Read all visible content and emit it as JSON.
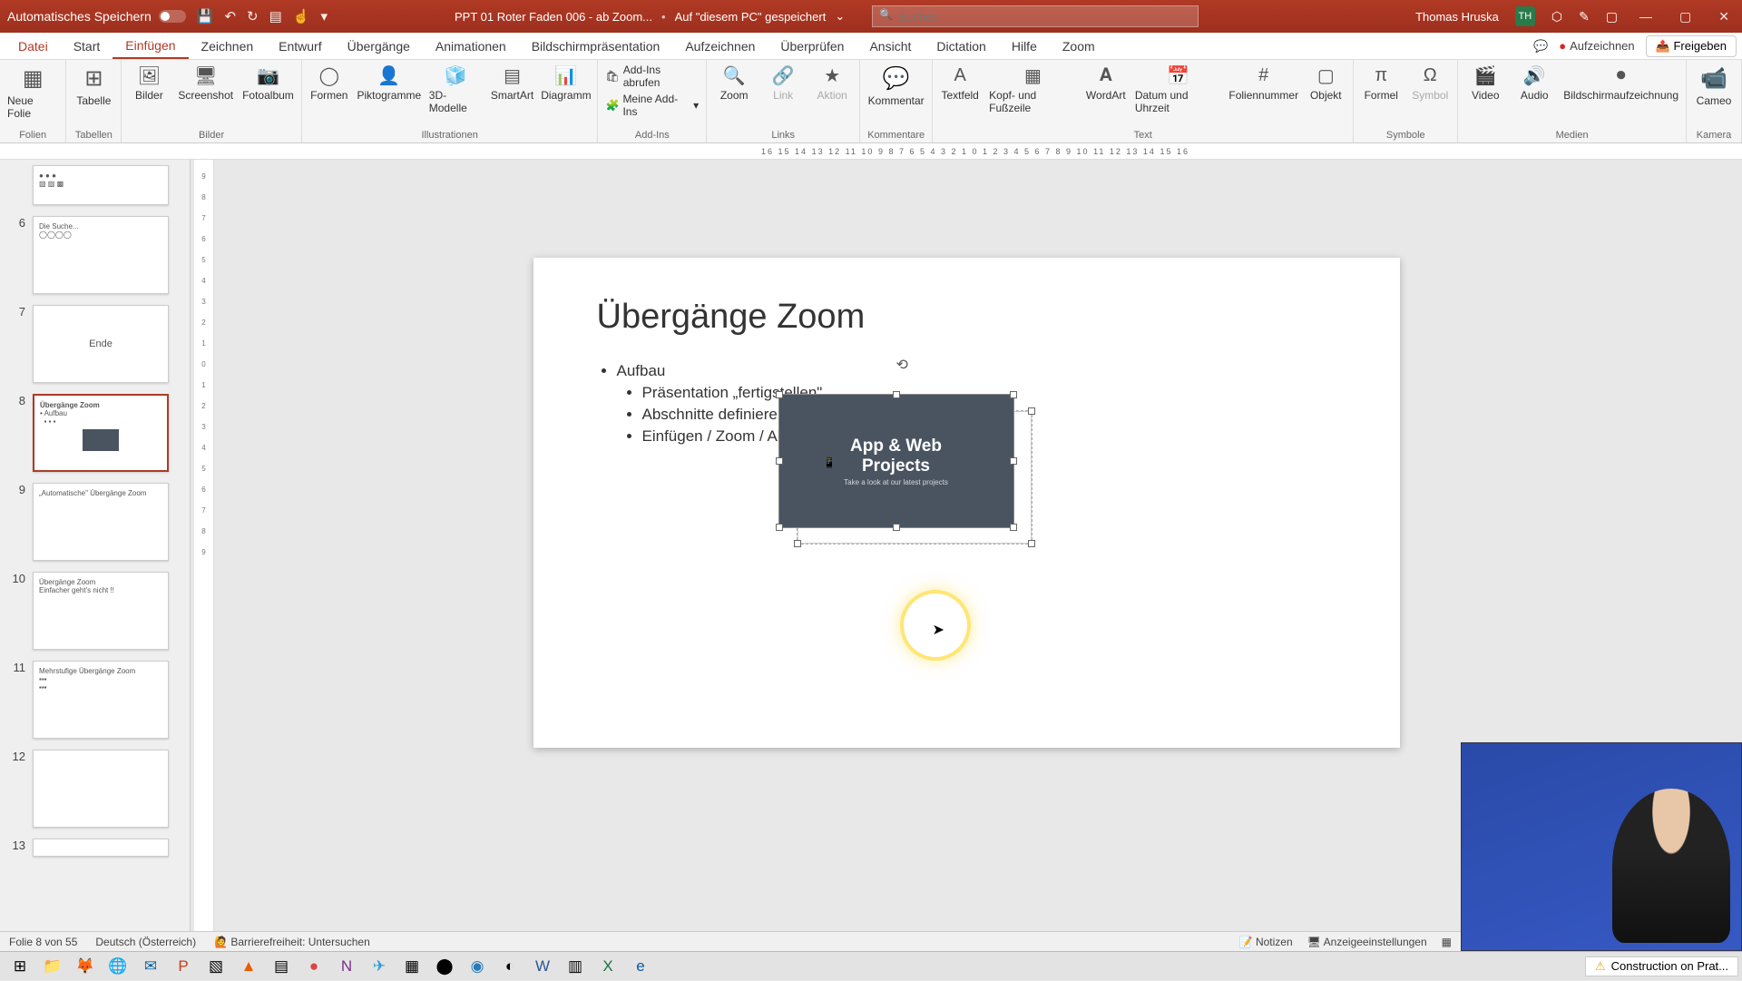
{
  "titlebar": {
    "autosave": "Automatisches Speichern",
    "docname": "PPT 01 Roter Faden 006 - ab Zoom...",
    "savedloc": "Auf \"diesem PC\" gespeichert",
    "search_placeholder": "Suchen",
    "username": "Thomas Hruska",
    "userinitials": "TH"
  },
  "menu": {
    "file": "Datei",
    "start": "Start",
    "insert": "Einfügen",
    "draw": "Zeichnen",
    "design": "Entwurf",
    "transitions": "Übergänge",
    "animations": "Animationen",
    "slideshow": "Bildschirmpräsentation",
    "record_tab": "Aufzeichnen",
    "review": "Überprüfen",
    "view": "Ansicht",
    "dictation": "Dictation",
    "help": "Hilfe",
    "zoom": "Zoom",
    "record_btn": "Aufzeichnen",
    "share_btn": "Freigeben"
  },
  "ribbon": {
    "g_slides": "Folien",
    "neue_folie": "Neue Folie",
    "g_tables": "Tabellen",
    "tabelle": "Tabelle",
    "g_images": "Bilder",
    "bilder": "Bilder",
    "screenshot": "Screenshot",
    "fotoalbum": "Fotoalbum",
    "g_illust": "Illustrationen",
    "formen": "Formen",
    "piktogramme": "Piktogramme",
    "models": "3D-Modelle",
    "smartart": "SmartArt",
    "diagramm": "Diagramm",
    "g_addins": "Add-Ins",
    "addins_get": "Add-Ins abrufen",
    "addins_my": "Meine Add-Ins",
    "g_links": "Links",
    "zoom_btn": "Zoom",
    "link": "Link",
    "aktion": "Aktion",
    "g_comments": "Kommentare",
    "kommentar": "Kommentar",
    "g_text": "Text",
    "textfeld": "Textfeld",
    "kopffuss": "Kopf- und Fußzeile",
    "wordart": "WordArt",
    "datum": "Datum und Uhrzeit",
    "foliennr": "Foliennummer",
    "objekt": "Objekt",
    "g_symbols": "Symbole",
    "formel": "Formel",
    "symbol": "Symbol",
    "g_media": "Medien",
    "video": "Video",
    "audio": "Audio",
    "screenrec": "Bildschirmaufzeichnung",
    "g_camera": "Kamera",
    "cameo": "Cameo"
  },
  "thumbs": {
    "t6": "6",
    "t7": "7",
    "t7_text": "Ende",
    "t8": "8",
    "t8_title": "Übergänge Zoom",
    "t9": "9",
    "t9_title": "„Automatische\" Übergänge Zoom",
    "t10": "10",
    "t10_title": "Übergänge Zoom",
    "t10_sub": "Einfacher geht's nicht !!",
    "t11": "11",
    "t11_title": "Mehrstufige Übergänge Zoom",
    "t12": "12",
    "t13": "13"
  },
  "slide": {
    "title": "Übergänge Zoom",
    "b1": "Aufbau",
    "b1a": "Präsentation „fertigstellen\"",
    "b1b": "Abschnitte definieren",
    "b1c": "Einfügen / Zoom / Abschnittzoom",
    "zoom_title1": "App & Web",
    "zoom_title2": "Projects",
    "zoom_sub": "Take a look at our latest projects"
  },
  "statusbar": {
    "slidecount": "Folie 8 von 55",
    "lang": "Deutsch (Österreich)",
    "access": "Barrierefreiheit: Untersuchen",
    "notes": "Notizen",
    "display": "Anzeigeeinstellungen"
  },
  "taskbar": {
    "notif": "Construction on Prat..."
  },
  "ruler_text": "16  15  14  13  12  11  10  9  8  7  6  5  4  3  2  1  0  1  2  3  4  5  6  7  8  9  10  11  12  13  14  15  16"
}
